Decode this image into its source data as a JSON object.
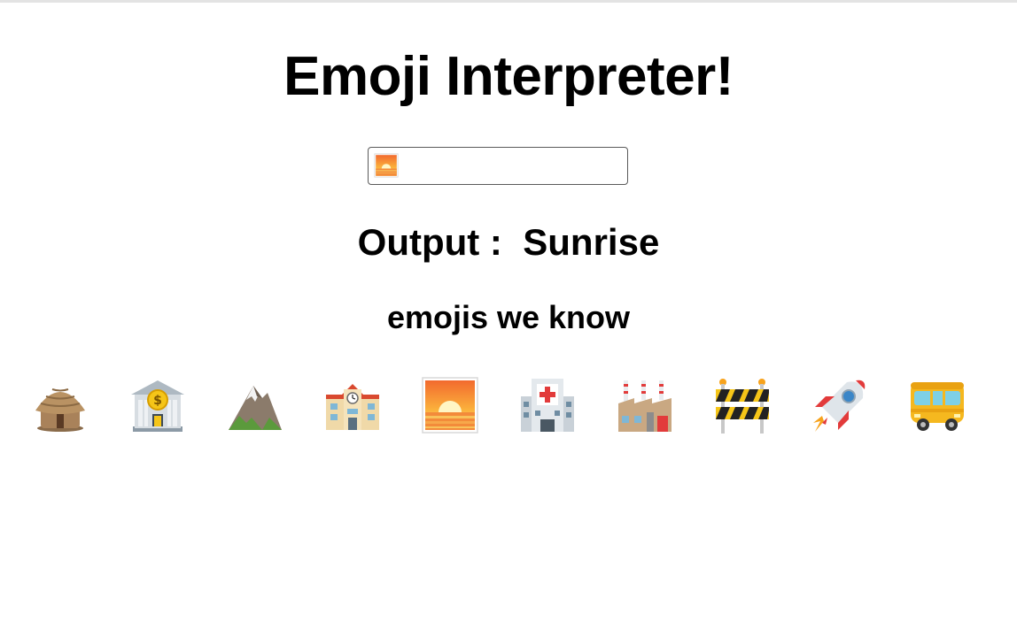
{
  "title": "Emoji Interpreter!",
  "input": {
    "value": "🌅",
    "placeholder": ""
  },
  "output": {
    "label": "Output :",
    "value": "Sunrise"
  },
  "known_heading": "emojis we know",
  "emojis": [
    {
      "char": "🛖",
      "icon": "hut-icon"
    },
    {
      "char": "🏦",
      "icon": "bank-icon"
    },
    {
      "char": "⛰️",
      "icon": "mountain-icon"
    },
    {
      "char": "🏫",
      "icon": "school-icon"
    },
    {
      "char": "🌅",
      "icon": "sunrise-icon"
    },
    {
      "char": "🏥",
      "icon": "hospital-icon"
    },
    {
      "char": "🏭",
      "icon": "factory-icon"
    },
    {
      "char": "🚧",
      "icon": "construction-icon"
    },
    {
      "char": "🚀",
      "icon": "rocket-icon"
    },
    {
      "char": "🚐",
      "icon": "minibus-icon"
    }
  ]
}
